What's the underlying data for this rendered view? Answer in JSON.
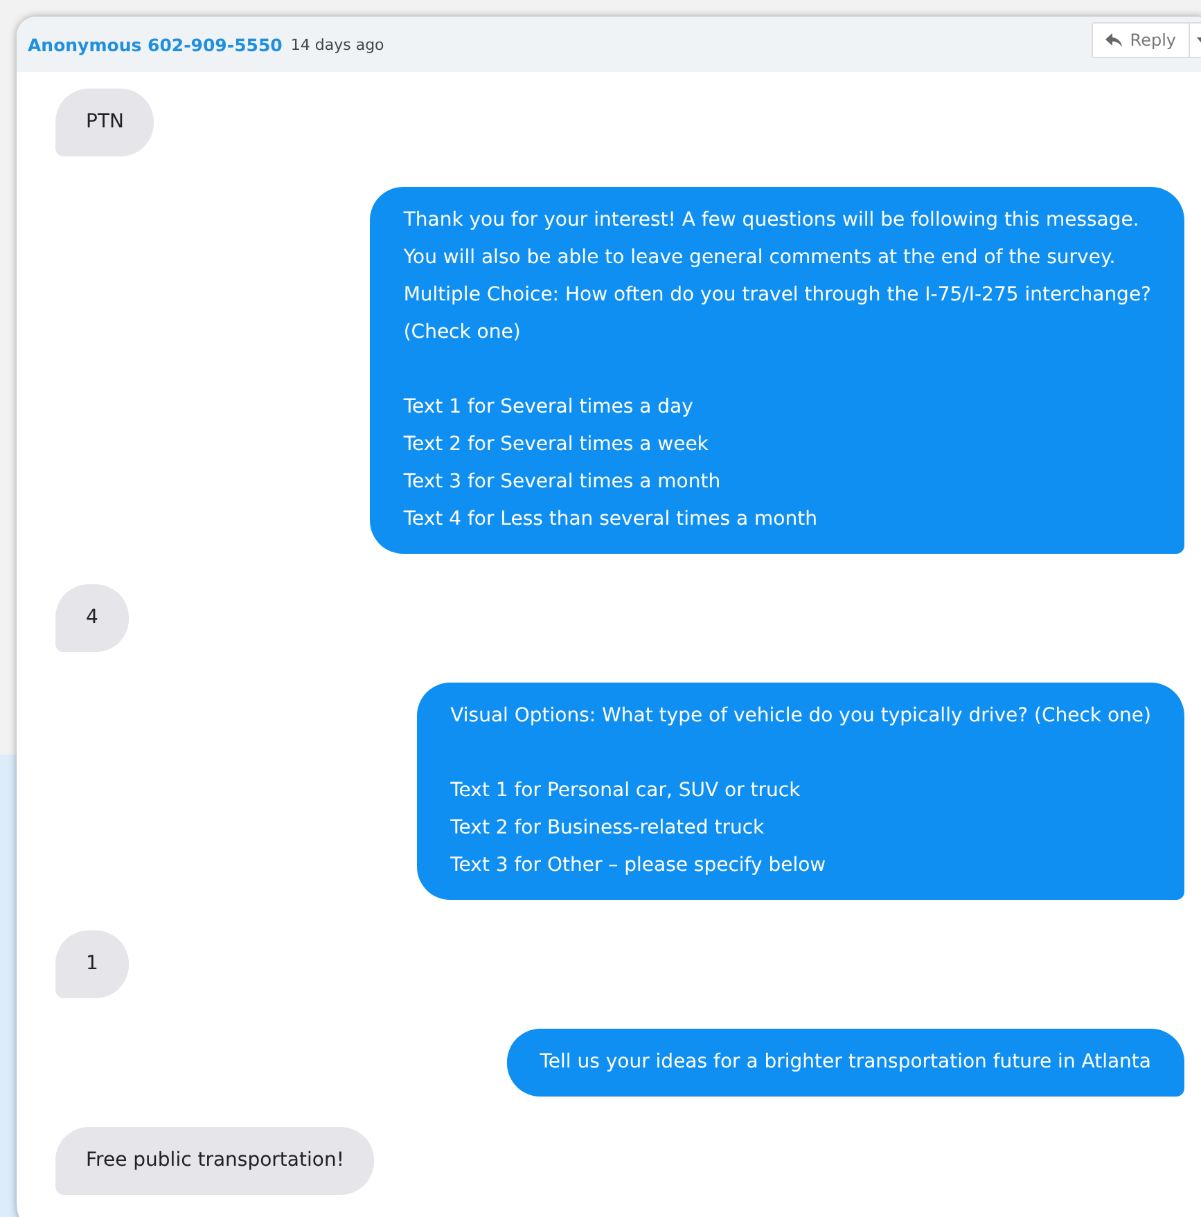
{
  "header": {
    "sender": "Anonymous 602-909-5550",
    "time": "14 days ago",
    "reply_button": "Reply"
  },
  "messages": [
    {
      "kind": "received",
      "text": "PTN"
    },
    {
      "kind": "sent",
      "text": "Thank you for your interest! A few questions will be following this message.\nYou will also be able to leave general comments at the end of the survey.\nMultiple Choice: How often do you travel through the I-75/I-275 interchange?\n(Check one)\n\nText 1 for Several times a day\nText 2 for Several times a week\nText 3 for Several times a month\nText 4 for Less than several times a month"
    },
    {
      "kind": "received",
      "text": "4"
    },
    {
      "kind": "sent",
      "text": "Visual Options: What type of vehicle do you typically drive? (Check one)\n\nText 1 for Personal car, SUV or truck\nText 2 for Business-related truck\nText 3 for Other – please specify below"
    },
    {
      "kind": "received",
      "text": "1"
    },
    {
      "kind": "sent",
      "text": "Tell us your ideas for a brighter transportation future in Atlanta"
    },
    {
      "kind": "received",
      "text": "Free public transportation!"
    }
  ]
}
